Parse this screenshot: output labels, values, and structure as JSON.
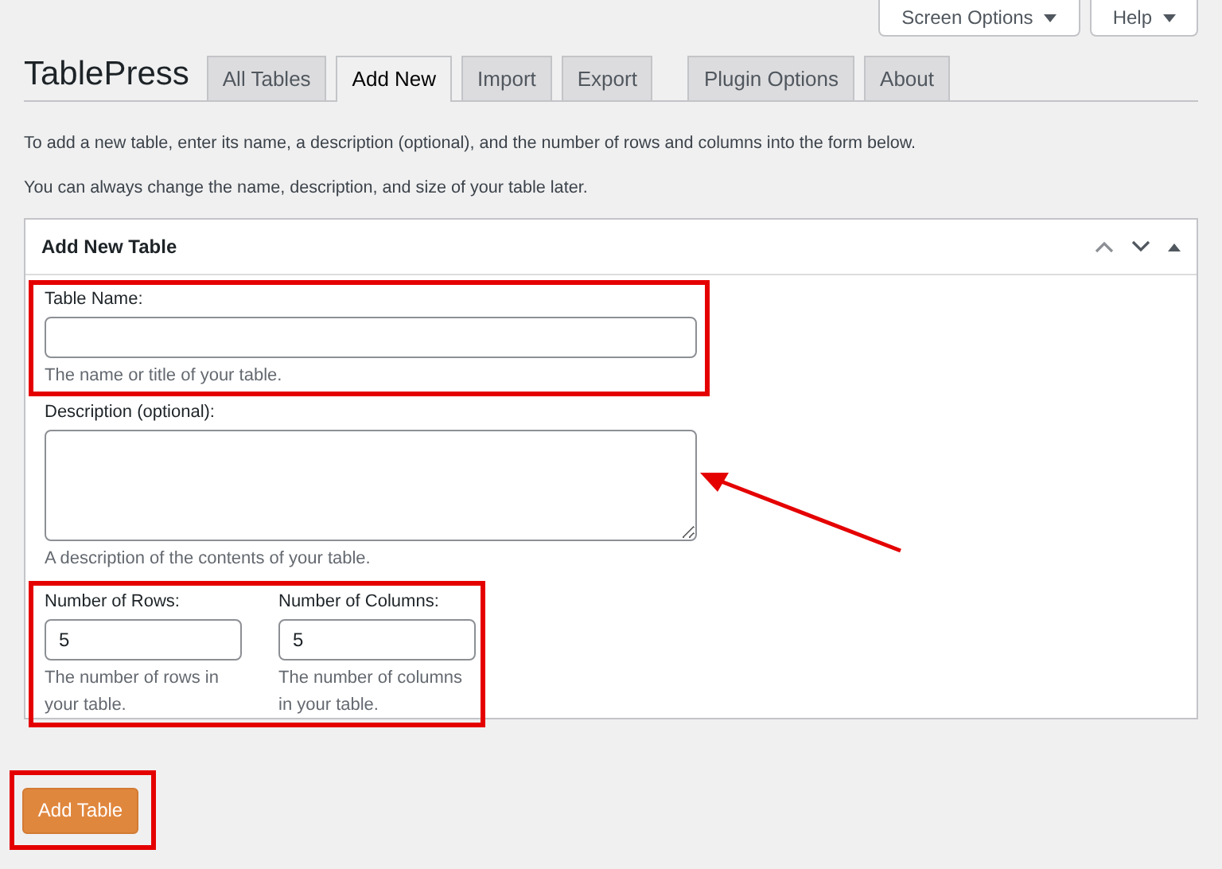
{
  "top_buttons": [
    {
      "label": "Screen Options"
    },
    {
      "label": "Help"
    }
  ],
  "heading": "TablePress",
  "tabs": [
    {
      "label": "All Tables",
      "selected": false
    },
    {
      "label": "Add New",
      "selected": true
    },
    {
      "label": "Import",
      "selected": false
    },
    {
      "label": "Export",
      "selected": false
    },
    {
      "label": "Plugin Options",
      "selected": false
    },
    {
      "label": "About",
      "selected": false
    }
  ],
  "intro": [
    "To add a new table, enter its name, a description (optional), and the number of rows and columns into the form below.",
    "You can always change the name, description, and size of your table later."
  ],
  "panel": {
    "title": "Add New Table",
    "name_field": {
      "label": "Table Name:",
      "hint": "The name or title of your table."
    },
    "description_field": {
      "label": "Description (optional):",
      "hint": "A description of the contents of your table."
    },
    "size_fields": [
      {
        "label": "Number of Rows:",
        "value": "5",
        "hint": "The number of rows in your table."
      },
      {
        "label": "Number of Columns:",
        "value": "5",
        "hint": "The number of columns in your table."
      }
    ]
  },
  "submit": "Add Table"
}
